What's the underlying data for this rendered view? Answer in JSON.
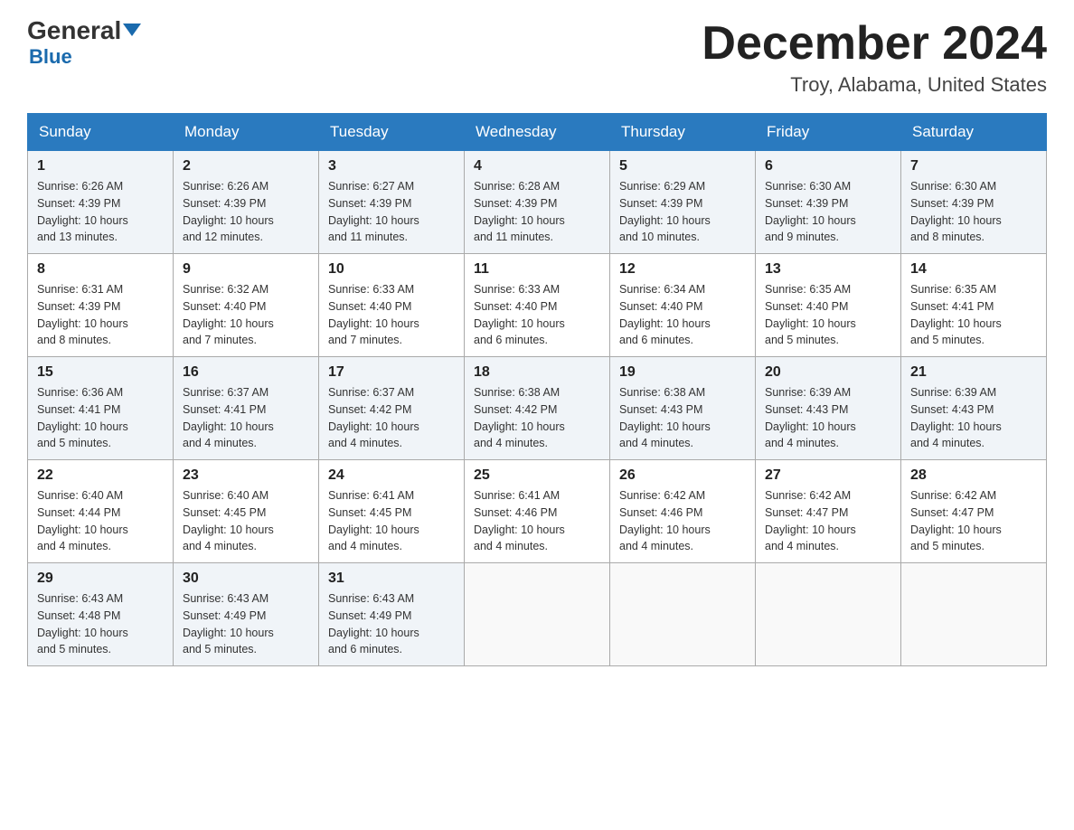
{
  "logo": {
    "general": "General",
    "blue": "Blue",
    "line2": "Blue"
  },
  "title": "December 2024",
  "subtitle": "Troy, Alabama, United States",
  "days_of_week": [
    "Sunday",
    "Monday",
    "Tuesday",
    "Wednesday",
    "Thursday",
    "Friday",
    "Saturday"
  ],
  "weeks": [
    [
      {
        "day": "1",
        "sunrise": "6:26 AM",
        "sunset": "4:39 PM",
        "daylight": "10 hours and 13 minutes."
      },
      {
        "day": "2",
        "sunrise": "6:26 AM",
        "sunset": "4:39 PM",
        "daylight": "10 hours and 12 minutes."
      },
      {
        "day": "3",
        "sunrise": "6:27 AM",
        "sunset": "4:39 PM",
        "daylight": "10 hours and 11 minutes."
      },
      {
        "day": "4",
        "sunrise": "6:28 AM",
        "sunset": "4:39 PM",
        "daylight": "10 hours and 11 minutes."
      },
      {
        "day": "5",
        "sunrise": "6:29 AM",
        "sunset": "4:39 PM",
        "daylight": "10 hours and 10 minutes."
      },
      {
        "day": "6",
        "sunrise": "6:30 AM",
        "sunset": "4:39 PM",
        "daylight": "10 hours and 9 minutes."
      },
      {
        "day": "7",
        "sunrise": "6:30 AM",
        "sunset": "4:39 PM",
        "daylight": "10 hours and 8 minutes."
      }
    ],
    [
      {
        "day": "8",
        "sunrise": "6:31 AM",
        "sunset": "4:39 PM",
        "daylight": "10 hours and 8 minutes."
      },
      {
        "day": "9",
        "sunrise": "6:32 AM",
        "sunset": "4:40 PM",
        "daylight": "10 hours and 7 minutes."
      },
      {
        "day": "10",
        "sunrise": "6:33 AM",
        "sunset": "4:40 PM",
        "daylight": "10 hours and 7 minutes."
      },
      {
        "day": "11",
        "sunrise": "6:33 AM",
        "sunset": "4:40 PM",
        "daylight": "10 hours and 6 minutes."
      },
      {
        "day": "12",
        "sunrise": "6:34 AM",
        "sunset": "4:40 PM",
        "daylight": "10 hours and 6 minutes."
      },
      {
        "day": "13",
        "sunrise": "6:35 AM",
        "sunset": "4:40 PM",
        "daylight": "10 hours and 5 minutes."
      },
      {
        "day": "14",
        "sunrise": "6:35 AM",
        "sunset": "4:41 PM",
        "daylight": "10 hours and 5 minutes."
      }
    ],
    [
      {
        "day": "15",
        "sunrise": "6:36 AM",
        "sunset": "4:41 PM",
        "daylight": "10 hours and 5 minutes."
      },
      {
        "day": "16",
        "sunrise": "6:37 AM",
        "sunset": "4:41 PM",
        "daylight": "10 hours and 4 minutes."
      },
      {
        "day": "17",
        "sunrise": "6:37 AM",
        "sunset": "4:42 PM",
        "daylight": "10 hours and 4 minutes."
      },
      {
        "day": "18",
        "sunrise": "6:38 AM",
        "sunset": "4:42 PM",
        "daylight": "10 hours and 4 minutes."
      },
      {
        "day": "19",
        "sunrise": "6:38 AM",
        "sunset": "4:43 PM",
        "daylight": "10 hours and 4 minutes."
      },
      {
        "day": "20",
        "sunrise": "6:39 AM",
        "sunset": "4:43 PM",
        "daylight": "10 hours and 4 minutes."
      },
      {
        "day": "21",
        "sunrise": "6:39 AM",
        "sunset": "4:43 PM",
        "daylight": "10 hours and 4 minutes."
      }
    ],
    [
      {
        "day": "22",
        "sunrise": "6:40 AM",
        "sunset": "4:44 PM",
        "daylight": "10 hours and 4 minutes."
      },
      {
        "day": "23",
        "sunrise": "6:40 AM",
        "sunset": "4:45 PM",
        "daylight": "10 hours and 4 minutes."
      },
      {
        "day": "24",
        "sunrise": "6:41 AM",
        "sunset": "4:45 PM",
        "daylight": "10 hours and 4 minutes."
      },
      {
        "day": "25",
        "sunrise": "6:41 AM",
        "sunset": "4:46 PM",
        "daylight": "10 hours and 4 minutes."
      },
      {
        "day": "26",
        "sunrise": "6:42 AM",
        "sunset": "4:46 PM",
        "daylight": "10 hours and 4 minutes."
      },
      {
        "day": "27",
        "sunrise": "6:42 AM",
        "sunset": "4:47 PM",
        "daylight": "10 hours and 4 minutes."
      },
      {
        "day": "28",
        "sunrise": "6:42 AM",
        "sunset": "4:47 PM",
        "daylight": "10 hours and 5 minutes."
      }
    ],
    [
      {
        "day": "29",
        "sunrise": "6:43 AM",
        "sunset": "4:48 PM",
        "daylight": "10 hours and 5 minutes."
      },
      {
        "day": "30",
        "sunrise": "6:43 AM",
        "sunset": "4:49 PM",
        "daylight": "10 hours and 5 minutes."
      },
      {
        "day": "31",
        "sunrise": "6:43 AM",
        "sunset": "4:49 PM",
        "daylight": "10 hours and 6 minutes."
      },
      null,
      null,
      null,
      null
    ]
  ],
  "labels": {
    "sunrise": "Sunrise:",
    "sunset": "Sunset:",
    "daylight": "Daylight:"
  }
}
